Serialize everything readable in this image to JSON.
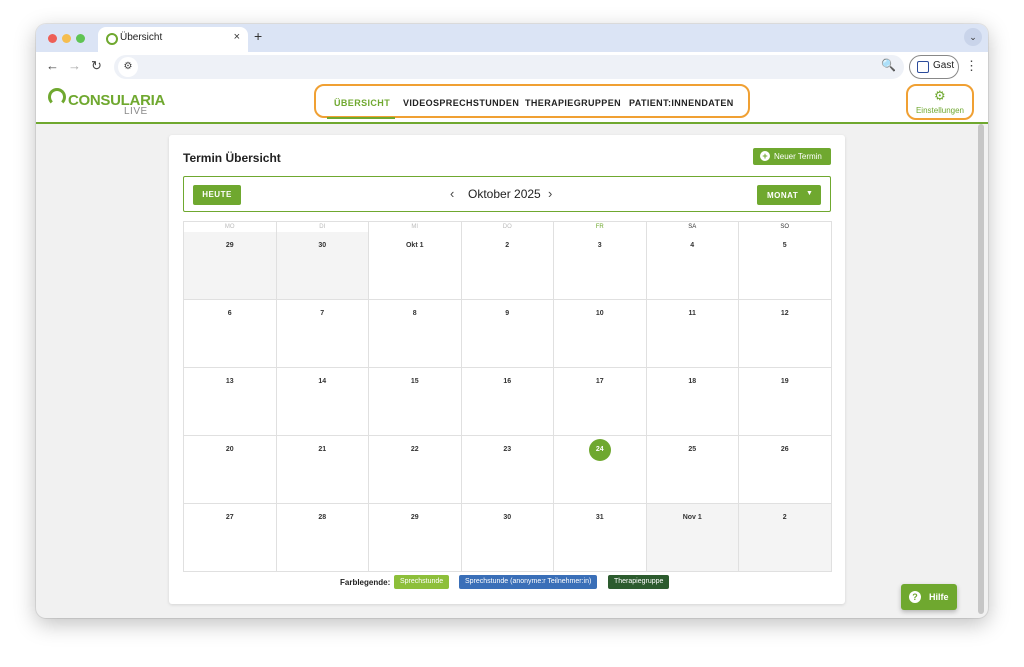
{
  "browser": {
    "tab_title": "Übersicht",
    "tab_close": "×",
    "new_tab": "+",
    "tab_menu": "⌄",
    "back": "←",
    "forward": "→",
    "reload": "↻",
    "site_settings": "⚙",
    "zoom": "🔍",
    "profile_label": "Gast",
    "menu": "⋮",
    "traffic_lights": {
      "close": "#ee5f57",
      "minimize": "#f5bd4f",
      "zoom": "#5fc453"
    }
  },
  "app": {
    "logo_name": "CONSULARIA",
    "logo_sub": "LIVE",
    "brand_color": "#6fa82f",
    "highlight_color": "#f0a033",
    "nav": [
      {
        "label": "ÜBERSICHT",
        "active": true
      },
      {
        "label": "VIDEOSPRECHSTUNDEN",
        "active": false
      },
      {
        "label": "THERAPIEGRUPPEN",
        "active": false
      },
      {
        "label": "PATIENT:INNENDATEN",
        "active": false
      }
    ],
    "settings_label": "Einstellungen",
    "settings_icon": "⚙"
  },
  "overview": {
    "title": "Termin Übersicht",
    "new_appointment_label": "Neuer Termin",
    "today_label": "HEUTE",
    "prev": "‹",
    "next": "›",
    "month_title": "Oktober 2025",
    "view_label": "MONAT",
    "view_caret": "▼",
    "weekdays": [
      "MO",
      "DI",
      "MI",
      "DO",
      "FR",
      "SA",
      "SO"
    ],
    "weeks": [
      [
        "29",
        "30",
        "Okt 1",
        "2",
        "3",
        "4",
        "5"
      ],
      [
        "6",
        "7",
        "8",
        "9",
        "10",
        "11",
        "12"
      ],
      [
        "13",
        "14",
        "15",
        "16",
        "17",
        "18",
        "19"
      ],
      [
        "20",
        "21",
        "22",
        "23",
        "24",
        "25",
        "26"
      ],
      [
        "27",
        "28",
        "29",
        "30",
        "31",
        "Nov 1",
        "2"
      ]
    ],
    "today": "24",
    "legend_title": "Farblegende:",
    "legend": [
      {
        "label": "Sprechstunde",
        "color": "#8dbf3a"
      },
      {
        "label": "Sprechstunde (anonyme:r Teilnehmer:in)",
        "color": "#3a6fb8"
      },
      {
        "label": "Therapiegruppe",
        "color": "#2c5b2e"
      }
    ]
  },
  "help": {
    "label": "Hilfe",
    "icon": "?"
  }
}
